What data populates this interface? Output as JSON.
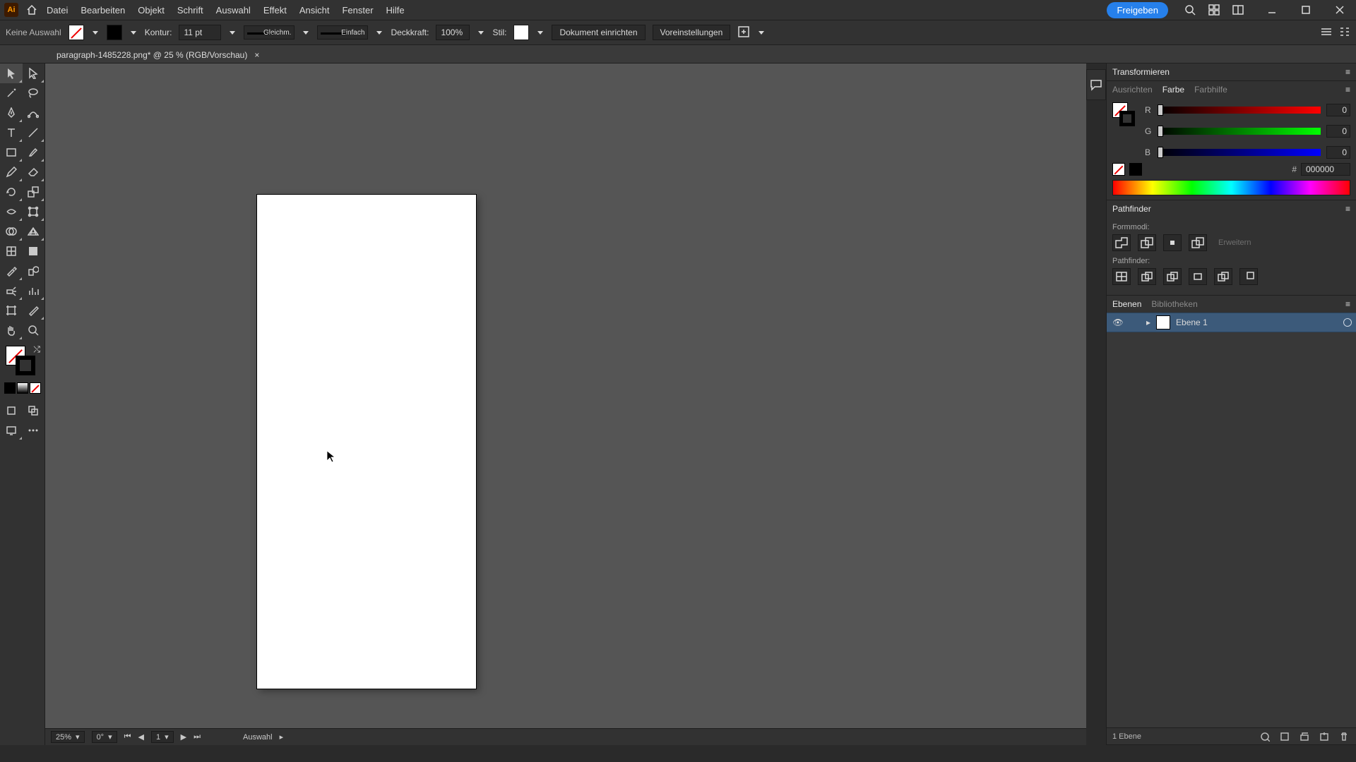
{
  "menubar": {
    "app_initials": "Ai",
    "items": [
      "Datei",
      "Bearbeiten",
      "Objekt",
      "Schrift",
      "Auswahl",
      "Effekt",
      "Ansicht",
      "Fenster",
      "Hilfe"
    ],
    "share_label": "Freigeben"
  },
  "controlbar": {
    "no_selection": "Keine Auswahl",
    "stroke_label": "Kontur:",
    "stroke_value": "11 pt",
    "brush1_label": "Gleichm.",
    "brush2_label": "Einfach",
    "opacity_label": "Deckkraft:",
    "opacity_value": "100%",
    "style_label": "Stil:",
    "doc_setup": "Dokument einrichten",
    "prefs": "Voreinstellungen"
  },
  "tab": {
    "title": "paragraph-1485228.png* @ 25 % (RGB/Vorschau)",
    "close": "×"
  },
  "panels": {
    "transform_tab": "Transformieren",
    "align_tab": "Ausrichten",
    "color_tab": "Farbe",
    "colorguide_tab": "Farbhilfe",
    "color": {
      "r_label": "R",
      "g_label": "G",
      "b_label": "B",
      "r": "0",
      "g": "0",
      "b": "0",
      "hex_prefix": "#",
      "hex": "000000"
    },
    "pathfinder_tab": "Pathfinder",
    "pf_shapemodes": "Formmodi:",
    "pf_expand": "Erweitern",
    "pf_pathfinders": "Pathfinder:",
    "layers_tab": "Ebenen",
    "libraries_tab": "Bibliotheken",
    "layer1": "Ebene 1",
    "layer_count": "1 Ebene"
  },
  "statusbar": {
    "zoom": "25%",
    "rotation": "0°",
    "artboard": "1",
    "tool": "Auswahl"
  }
}
